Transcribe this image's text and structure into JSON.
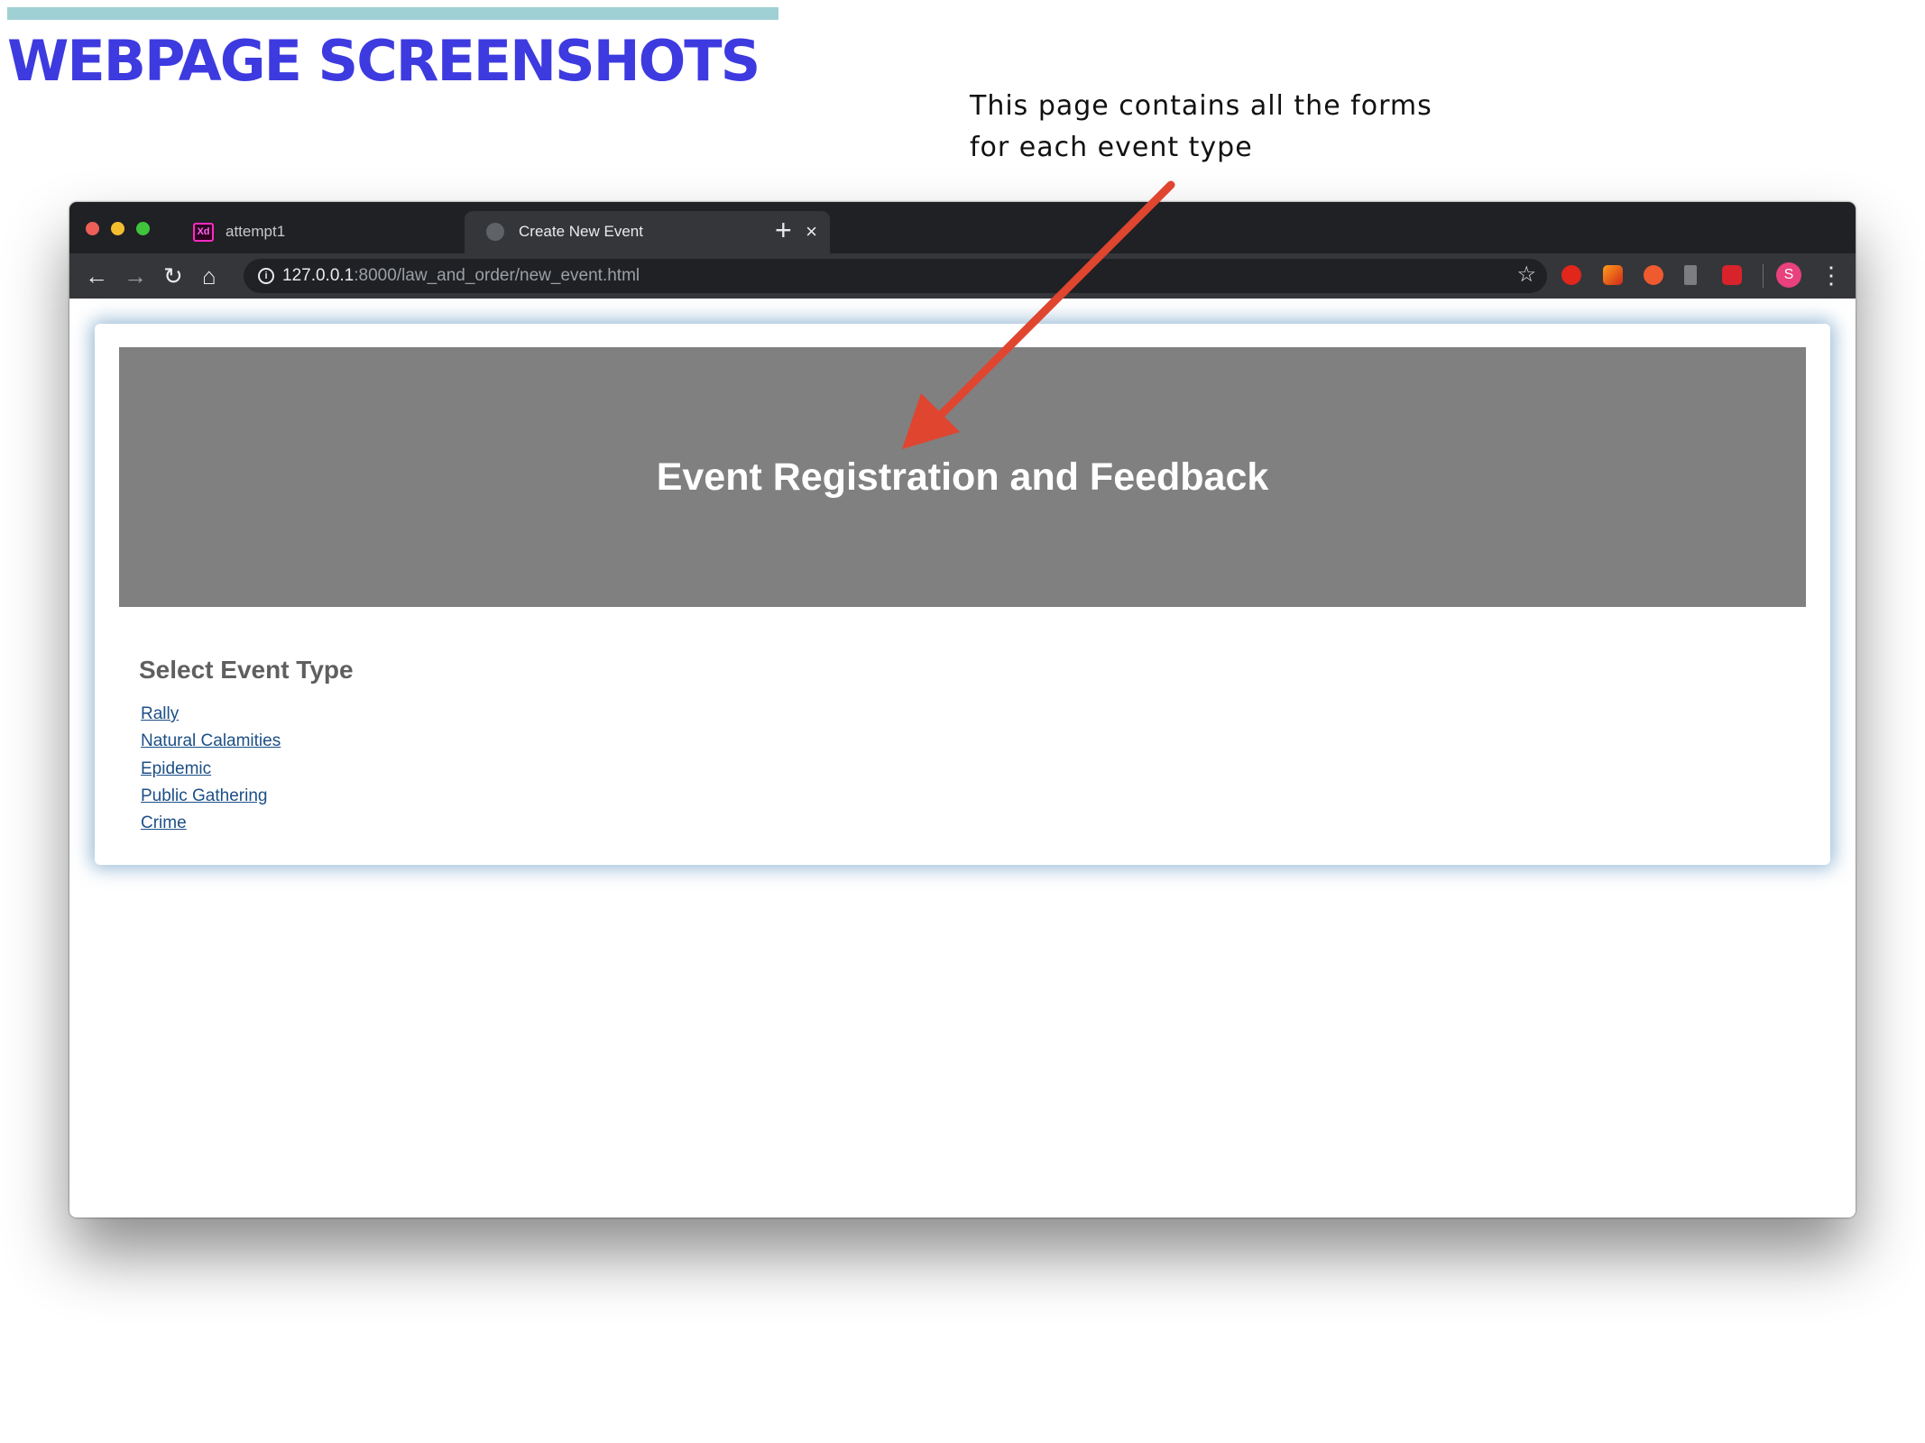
{
  "slide": {
    "title": "WEBPAGE SCREENSHOTS",
    "annotation_lines": [
      "This page contains all the forms",
      "for each event type"
    ],
    "accent_color": "#3d3ae0",
    "rule_color": "#9fd0d4",
    "arrow_color": "#e0452f"
  },
  "browser": {
    "tabs": [
      {
        "label": "attempt1",
        "icon": "adobe-xd-icon",
        "active": false
      },
      {
        "label": "Create New Event",
        "icon": "globe-icon",
        "active": true
      }
    ],
    "close_glyph": "×",
    "new_tab_glyph": "+",
    "url_host": "127.0.0.1",
    "url_rest": ":8000/law_and_order/new_event.html",
    "profile_initial": "S",
    "extensions": [
      "adblock-icon",
      "extension-icon",
      "extension-icon",
      "bookmark-icon",
      "extension-icon"
    ]
  },
  "page": {
    "banner_title": "Event Registration and Feedback",
    "banner_color": "#808080",
    "section_title": "Select Event Type",
    "event_types": [
      "Rally",
      "Natural Calamities",
      "Epidemic",
      "Public Gathering",
      "Crime"
    ],
    "link_color": "#1c4f87"
  }
}
